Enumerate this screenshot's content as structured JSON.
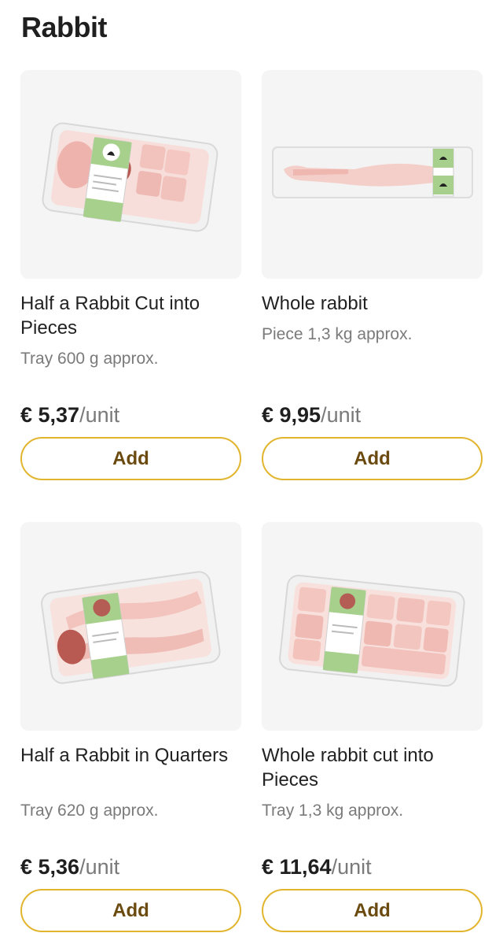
{
  "section": {
    "title": "Rabbit"
  },
  "products": [
    {
      "name": "Half a Rabbit Cut into Pieces",
      "size": "Tray 600 g approx.",
      "price": "€ 5,37",
      "unit": "/unit",
      "add_label": "Add",
      "image_icon": "rabbit-pieces-tray-image"
    },
    {
      "name": "Whole rabbit",
      "size": "Piece 1,3 kg approx.",
      "price": "€ 9,95",
      "unit": "/unit",
      "add_label": "Add",
      "image_icon": "whole-rabbit-package-image"
    },
    {
      "name": "Half a Rabbit in Quarters",
      "size": "Tray 620 g approx.",
      "price": "€ 5,36",
      "unit": "/unit",
      "add_label": "Add",
      "image_icon": "rabbit-quarters-tray-image"
    },
    {
      "name": "Whole rabbit cut into Pieces",
      "size": "Tray 1,3 kg approx.",
      "price": "€ 11,64",
      "unit": "/unit",
      "add_label": "Add",
      "image_icon": "whole-rabbit-pieces-tray-image"
    }
  ],
  "colors": {
    "button_border": "#e2b52f",
    "button_text": "#6b4a10",
    "thumb_bg": "#f5f5f5",
    "label_green": "#9fcb7a"
  }
}
